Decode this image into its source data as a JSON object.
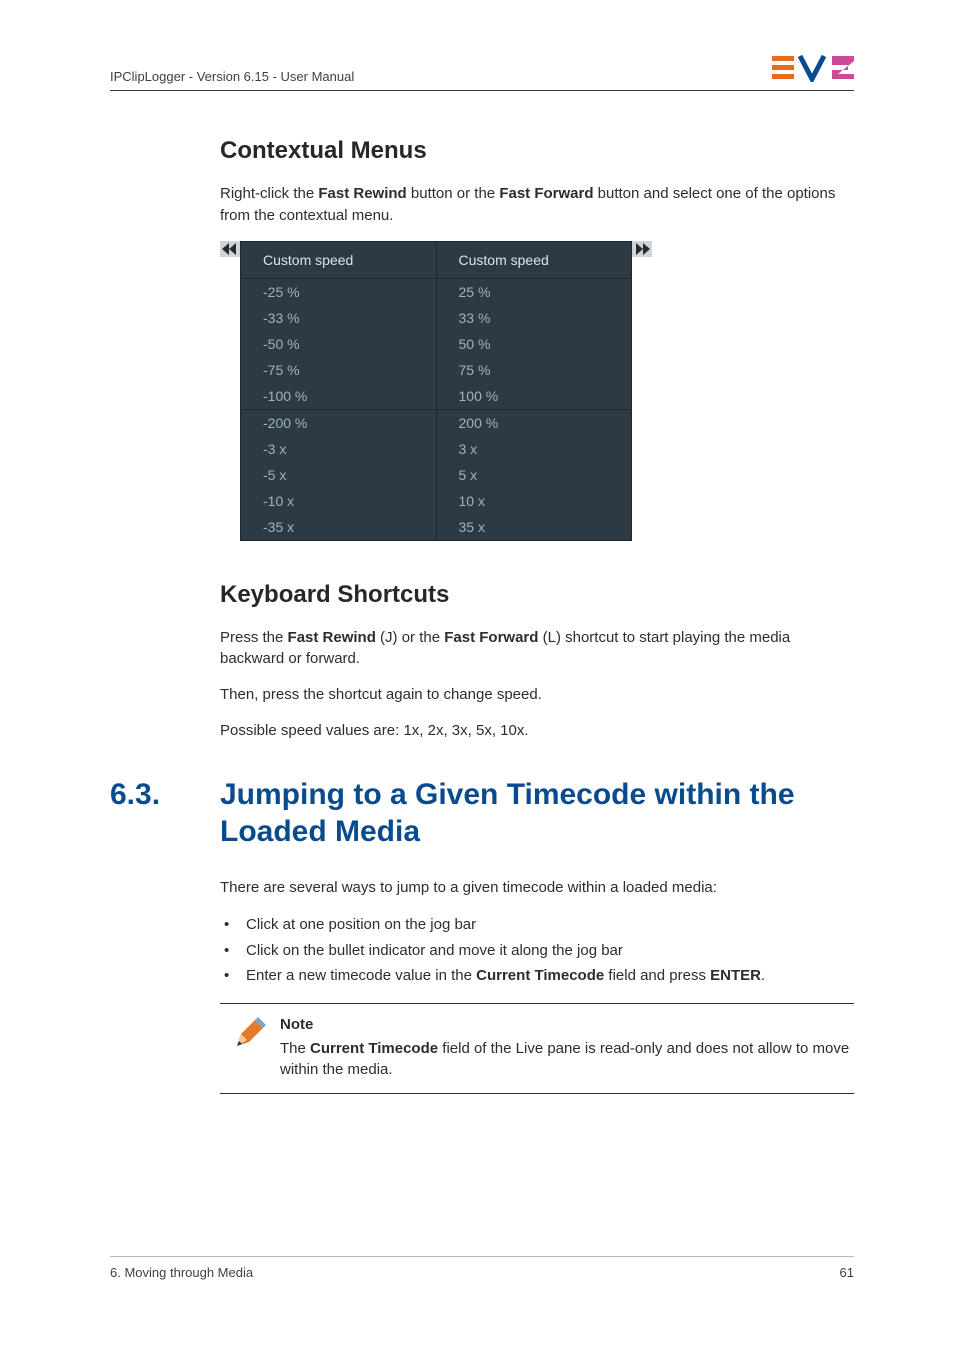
{
  "header": {
    "doc_title": "IPClipLogger - Version 6.15 - User Manual"
  },
  "section1": {
    "heading": "Contextual Menus",
    "intro_pre": "Right-click the ",
    "intro_b1": "Fast Rewind",
    "intro_mid": " button or the ",
    "intro_b2": "Fast Forward",
    "intro_post": " button and select one of the options from the contextual menu."
  },
  "menus": {
    "header_left": "Custom speed",
    "header_right": "Custom speed",
    "group1_left": [
      "-25 %",
      "-33 %",
      "-50 %",
      "-75 %",
      "-100 %"
    ],
    "group1_right": [
      "25 %",
      "33 %",
      "50 %",
      "75 %",
      "100 %"
    ],
    "group2_left": [
      "-200 %",
      "-3 x",
      "-5 x",
      "-10 x",
      "-35 x"
    ],
    "group2_right": [
      "200 %",
      "3 x",
      "5 x",
      "10 x",
      "35 x"
    ]
  },
  "section2": {
    "heading": "Keyboard Shortcuts",
    "p1_pre": "Press the ",
    "p1_b1": "Fast Rewind",
    "p1_mid1": " (J) or the ",
    "p1_b2": "Fast Forward",
    "p1_post": " (L) shortcut to start playing the media backward or forward.",
    "p2": "Then, press the shortcut again to change speed.",
    "p3": "Possible speed values are: 1x, 2x, 3x, 5x, 10x."
  },
  "section3": {
    "number": "6.3.",
    "heading": "Jumping to a Given Timecode within the Loaded Media",
    "intro": "There are several ways to jump to a given timecode within a loaded media:",
    "bullet1": "Click at one position on the jog bar",
    "bullet2": "Click on the bullet indicator and move it along the jog bar",
    "bullet3_pre": "Enter a new timecode value in the ",
    "bullet3_b1": "Current Timecode",
    "bullet3_mid": " field and press ",
    "bullet3_b2": "ENTER",
    "bullet3_post": "."
  },
  "note": {
    "title": "Note",
    "pre": "The ",
    "b1": "Current Timecode",
    "post": " field of the Live pane is read-only and does not allow to move within the media."
  },
  "footer": {
    "chapter": "6. Moving through Media",
    "page": "61"
  }
}
